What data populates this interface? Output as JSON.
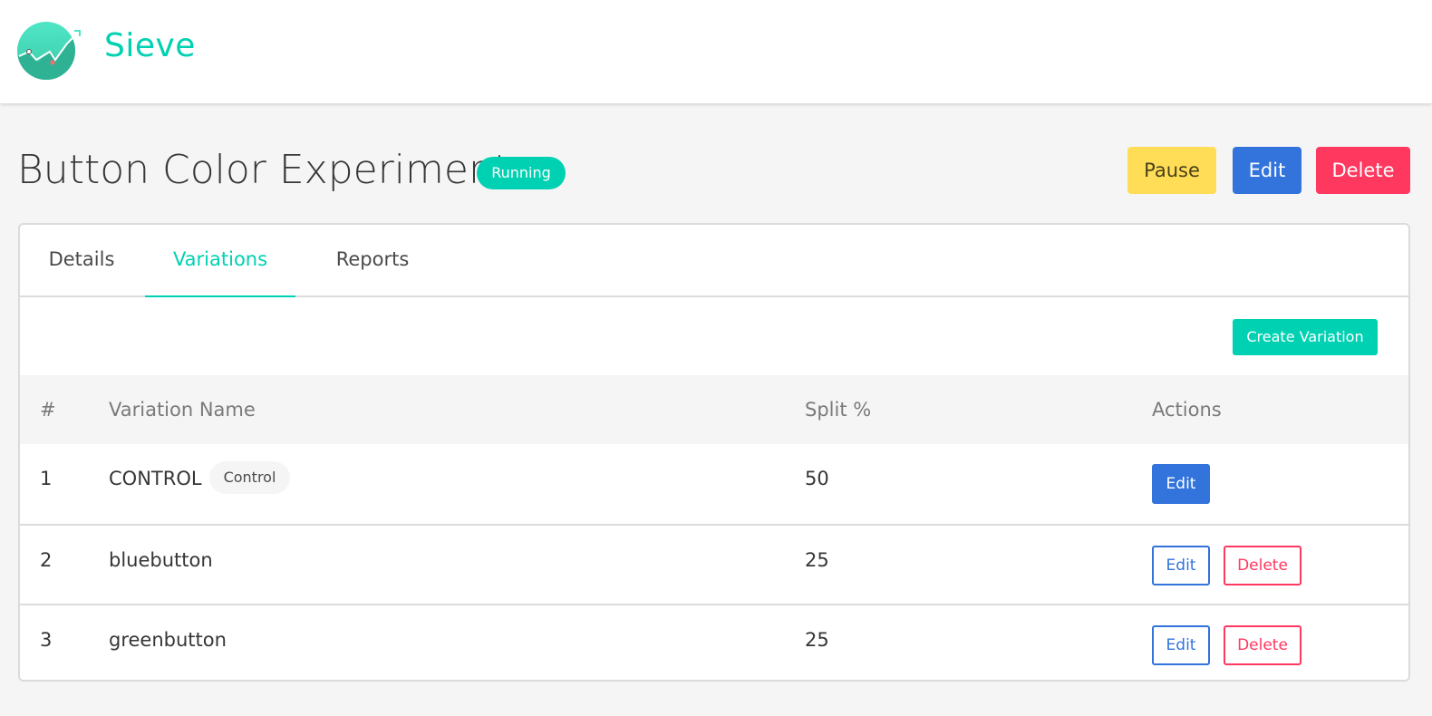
{
  "app": {
    "brand": "Sieve"
  },
  "page": {
    "title": "Button Color Experiment",
    "status": "Running",
    "actions": {
      "pause": "Pause",
      "edit": "Edit",
      "delete": "Delete"
    }
  },
  "tabs": [
    {
      "label": "Details",
      "active": false
    },
    {
      "label": "Variations",
      "active": true
    },
    {
      "label": "Reports",
      "active": false
    }
  ],
  "variations": {
    "create_label": "Create Variation",
    "columns": [
      "#",
      "Variation Name",
      "Split %",
      "Actions"
    ],
    "rows": [
      {
        "num": "1",
        "name": "CONTROL",
        "tag": "Control",
        "split": "50",
        "actions": [
          "Edit"
        ]
      },
      {
        "num": "2",
        "name": "bluebutton",
        "tag": null,
        "split": "25",
        "actions": [
          "Edit",
          "Delete"
        ]
      },
      {
        "num": "3",
        "name": "greenbutton",
        "tag": null,
        "split": "25",
        "actions": [
          "Edit",
          "Delete"
        ]
      }
    ]
  },
  "colors": {
    "primary": "#00d1b2",
    "link": "#3273dc",
    "danger": "#ff3860",
    "warning": "#ffdd57"
  },
  "icons": {
    "logo": "rising-chart-logo-icon"
  }
}
